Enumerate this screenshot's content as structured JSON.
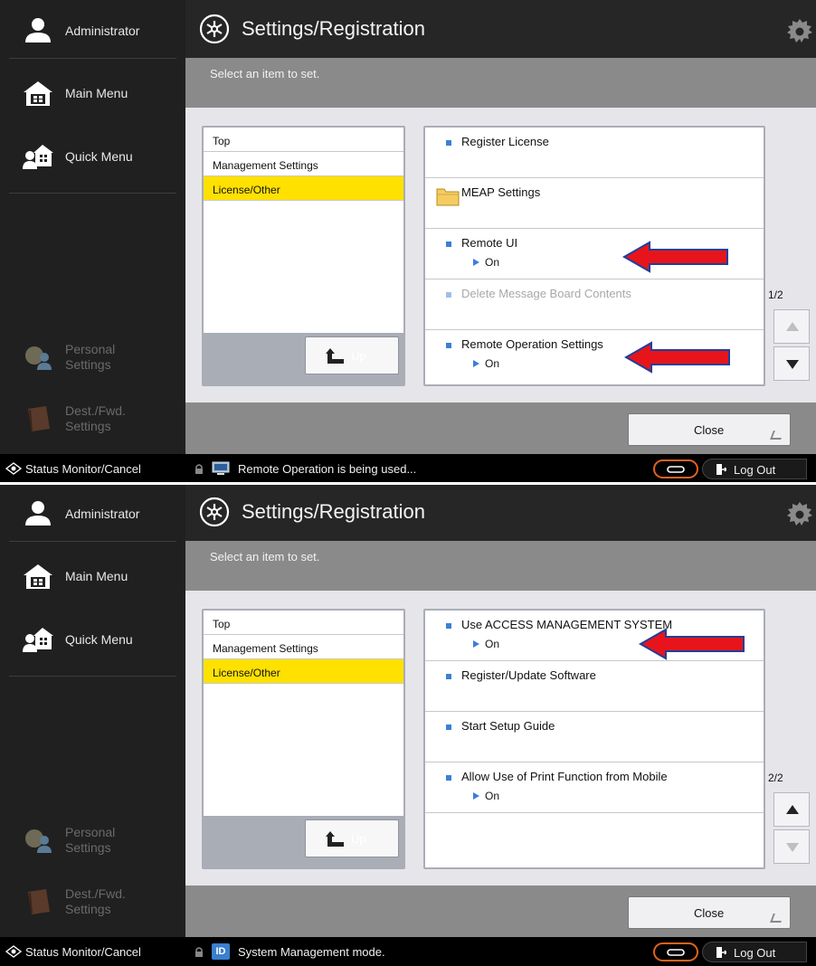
{
  "screens": [
    {
      "sidebar": {
        "user": "Administrator",
        "main_menu": "Main Menu",
        "quick_menu": "Quick Menu",
        "personal_settings": "Personal\nSettings",
        "dest_settings": "Dest./Fwd.\nSettings"
      },
      "header": {
        "title": "Settings/Registration"
      },
      "subheader": {
        "message": "Select an item to set."
      },
      "tree": {
        "items": [
          "Top",
          "Management Settings",
          "License/Other"
        ],
        "selected_index": 2,
        "up_label": "Up"
      },
      "items": [
        {
          "label": "Register License",
          "value": ""
        },
        {
          "label": "MEAP Settings",
          "value": ""
        },
        {
          "label": "Remote UI",
          "value": "On"
        },
        {
          "label": "Delete Message Board Contents",
          "value": ""
        },
        {
          "label": "Remote Operation Settings",
          "value": "On"
        }
      ],
      "pager": {
        "label": "1/2",
        "up_enabled": false,
        "down_enabled": true
      },
      "close_label": "Close",
      "status": {
        "monitor_label": "Status Monitor/Cancel",
        "message": "Remote Operation is being used...",
        "logout_label": "Log Out"
      },
      "annotation_color": "#e8141b"
    },
    {
      "sidebar": {
        "user": "Administrator",
        "main_menu": "Main Menu",
        "quick_menu": "Quick Menu",
        "personal_settings": "Personal\nSettings",
        "dest_settings": "Dest./Fwd.\nSettings"
      },
      "header": {
        "title": "Settings/Registration"
      },
      "subheader": {
        "message": "Select an item to set."
      },
      "tree": {
        "items": [
          "Top",
          "Management Settings",
          "License/Other"
        ],
        "selected_index": 2,
        "up_label": "Up"
      },
      "items": [
        {
          "label": "Use ACCESS MANAGEMENT SYSTEM",
          "value": "On"
        },
        {
          "label": "Register/Update Software",
          "value": ""
        },
        {
          "label": "Start Setup Guide",
          "value": ""
        },
        {
          "label": "Allow Use of Print Function from Mobile",
          "value": "On"
        },
        {
          "label": "",
          "value": ""
        }
      ],
      "pager": {
        "label": "2/2",
        "up_enabled": true,
        "down_enabled": false
      },
      "close_label": "Close",
      "status": {
        "monitor_label": "Status Monitor/Cancel",
        "message": "System Management mode.",
        "logout_label": "Log Out"
      },
      "annotation_color": "#e8141b"
    }
  ],
  "icons": {
    "user": "user-icon",
    "home": "home-icon",
    "quick_menu": "quick-menu-icon",
    "settings": "settings-registration-icon",
    "gear": "gear-icon",
    "folder": "folder-icon",
    "status_eye": "status-monitor-icon",
    "lock": "lock-icon",
    "remote_pc": "remote-pc-icon",
    "id": "id-icon",
    "link": "link-icon",
    "logout": "logout-icon"
  }
}
